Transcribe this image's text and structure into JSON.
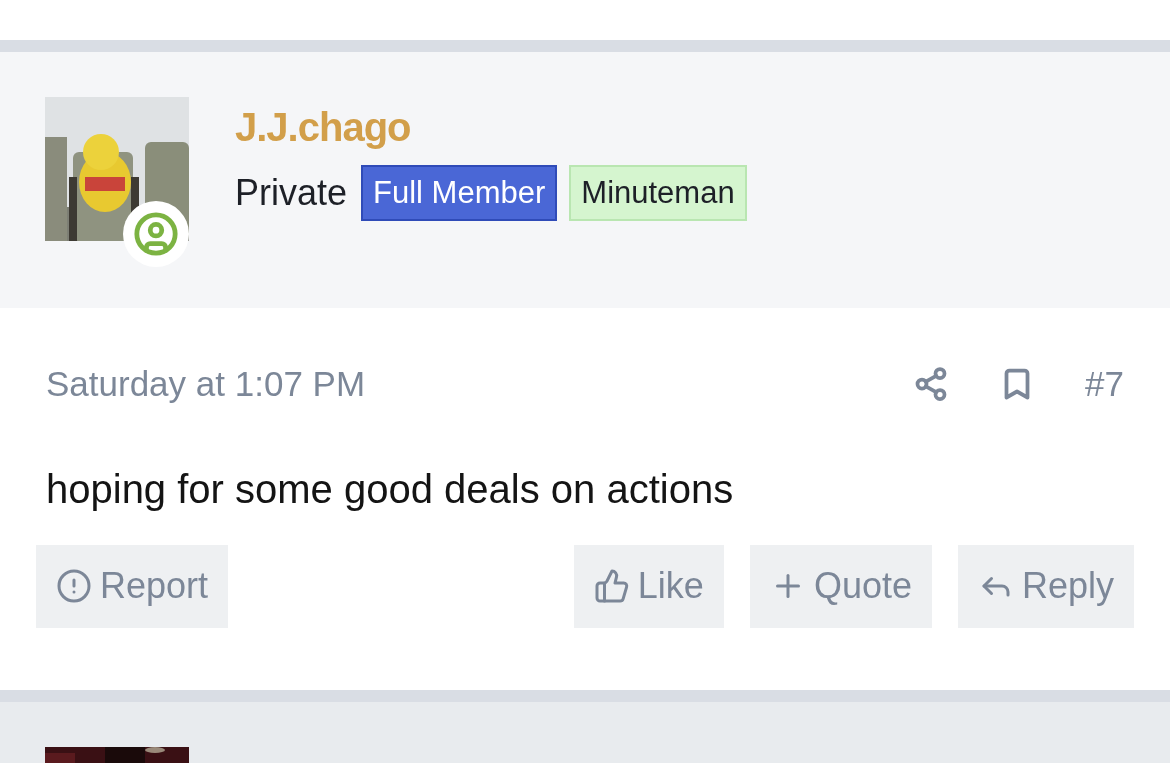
{
  "post": {
    "author": {
      "name": "J.J.chago",
      "rank": "Private",
      "online": true
    },
    "banners": [
      {
        "label": "Full Member",
        "kind": "solid",
        "color": "#4a67d6"
      },
      {
        "label": "Minuteman",
        "kind": "light",
        "color": "#d5f5cf"
      }
    ],
    "date": "Saturday at 1:07 PM",
    "number": "#7",
    "body": "hoping for some good deals on actions",
    "actions": [
      {
        "kind": "report",
        "label": "Report"
      },
      {
        "kind": "like",
        "label": "Like"
      },
      {
        "kind": "quote",
        "label": "Quote"
      },
      {
        "kind": "reply",
        "label": "Reply"
      }
    ]
  }
}
